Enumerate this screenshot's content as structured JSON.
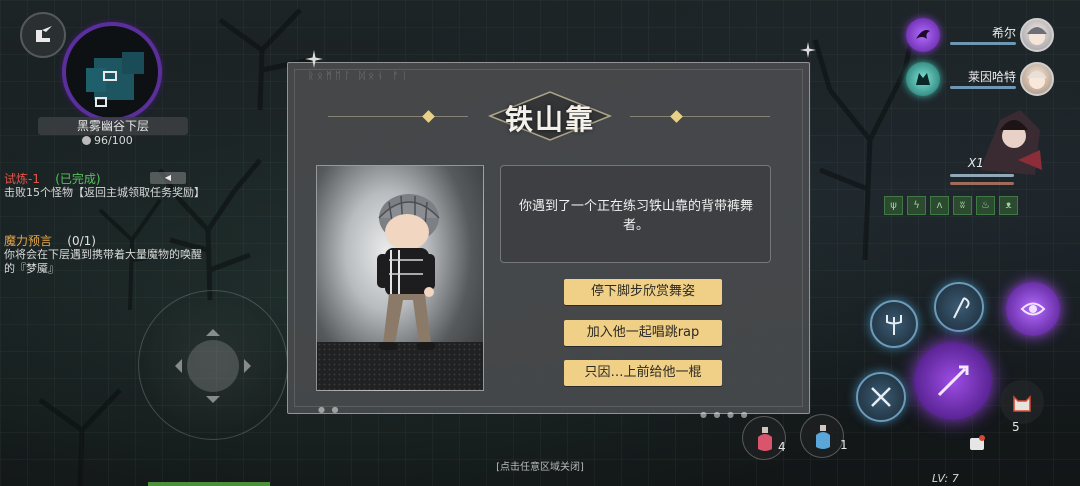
{
  "minimap": {
    "location_name": "黑雾幽谷下层",
    "progress_text": "96/100",
    "border_color": "#5a2f9a"
  },
  "quests": [
    {
      "name": "试炼-1",
      "status": "(已完成)",
      "description": "击败15个怪物【返回主城领取任务奖励】"
    },
    {
      "name": "魔力预言",
      "status": "(0/1)",
      "description": "你将会在下层遇到携带着大量魔物的唤醒的『梦魇』"
    }
  ],
  "event_dialog": {
    "title": "铁山靠",
    "message": "你遇到了一个正在练习铁山靠的背带裤舞者。",
    "choices": [
      "停下脚步欣赏舞姿",
      "加入他一起唱跳rap",
      "只因…上前给他一棍"
    ],
    "close_hint": "[点击任意区域关闭]",
    "choice_color": "#f0cf86"
  },
  "party": [
    {
      "name": "希尔",
      "orb_color": "#8a3fd1",
      "orb_icon": "dragon-emblem-icon"
    },
    {
      "name": "莱因哈特",
      "orb_color": "#3fb5a8",
      "orb_icon": "wolf-emblem-icon"
    }
  ],
  "combo": {
    "multiplier": "X1"
  },
  "buffs": [
    "beast-buff-icon",
    "claw-buff-icon",
    "wolf-buff-icon",
    "bird-buff-icon",
    "fire-buff-icon",
    "bear-buff-icon"
  ],
  "skills": [
    {
      "icon": "trident-skill-icon"
    },
    {
      "icon": "scythe-skill-icon"
    },
    {
      "icon": "eye-rune-skill-icon"
    },
    {
      "icon": "spear-skill-icon"
    },
    {
      "icon": "crossed-swords-skill-icon"
    },
    {
      "icon": "dash-skill-icon"
    }
  ],
  "potions": [
    {
      "icon": "red-potion-icon",
      "count": "4",
      "color": "#d8556c"
    },
    {
      "icon": "blue-potion-icon",
      "count": "1",
      "color": "#5aa6d8"
    }
  ],
  "pet": {
    "icon": "cat-pet-icon",
    "count": "5"
  },
  "player": {
    "level": "LV: 7"
  }
}
